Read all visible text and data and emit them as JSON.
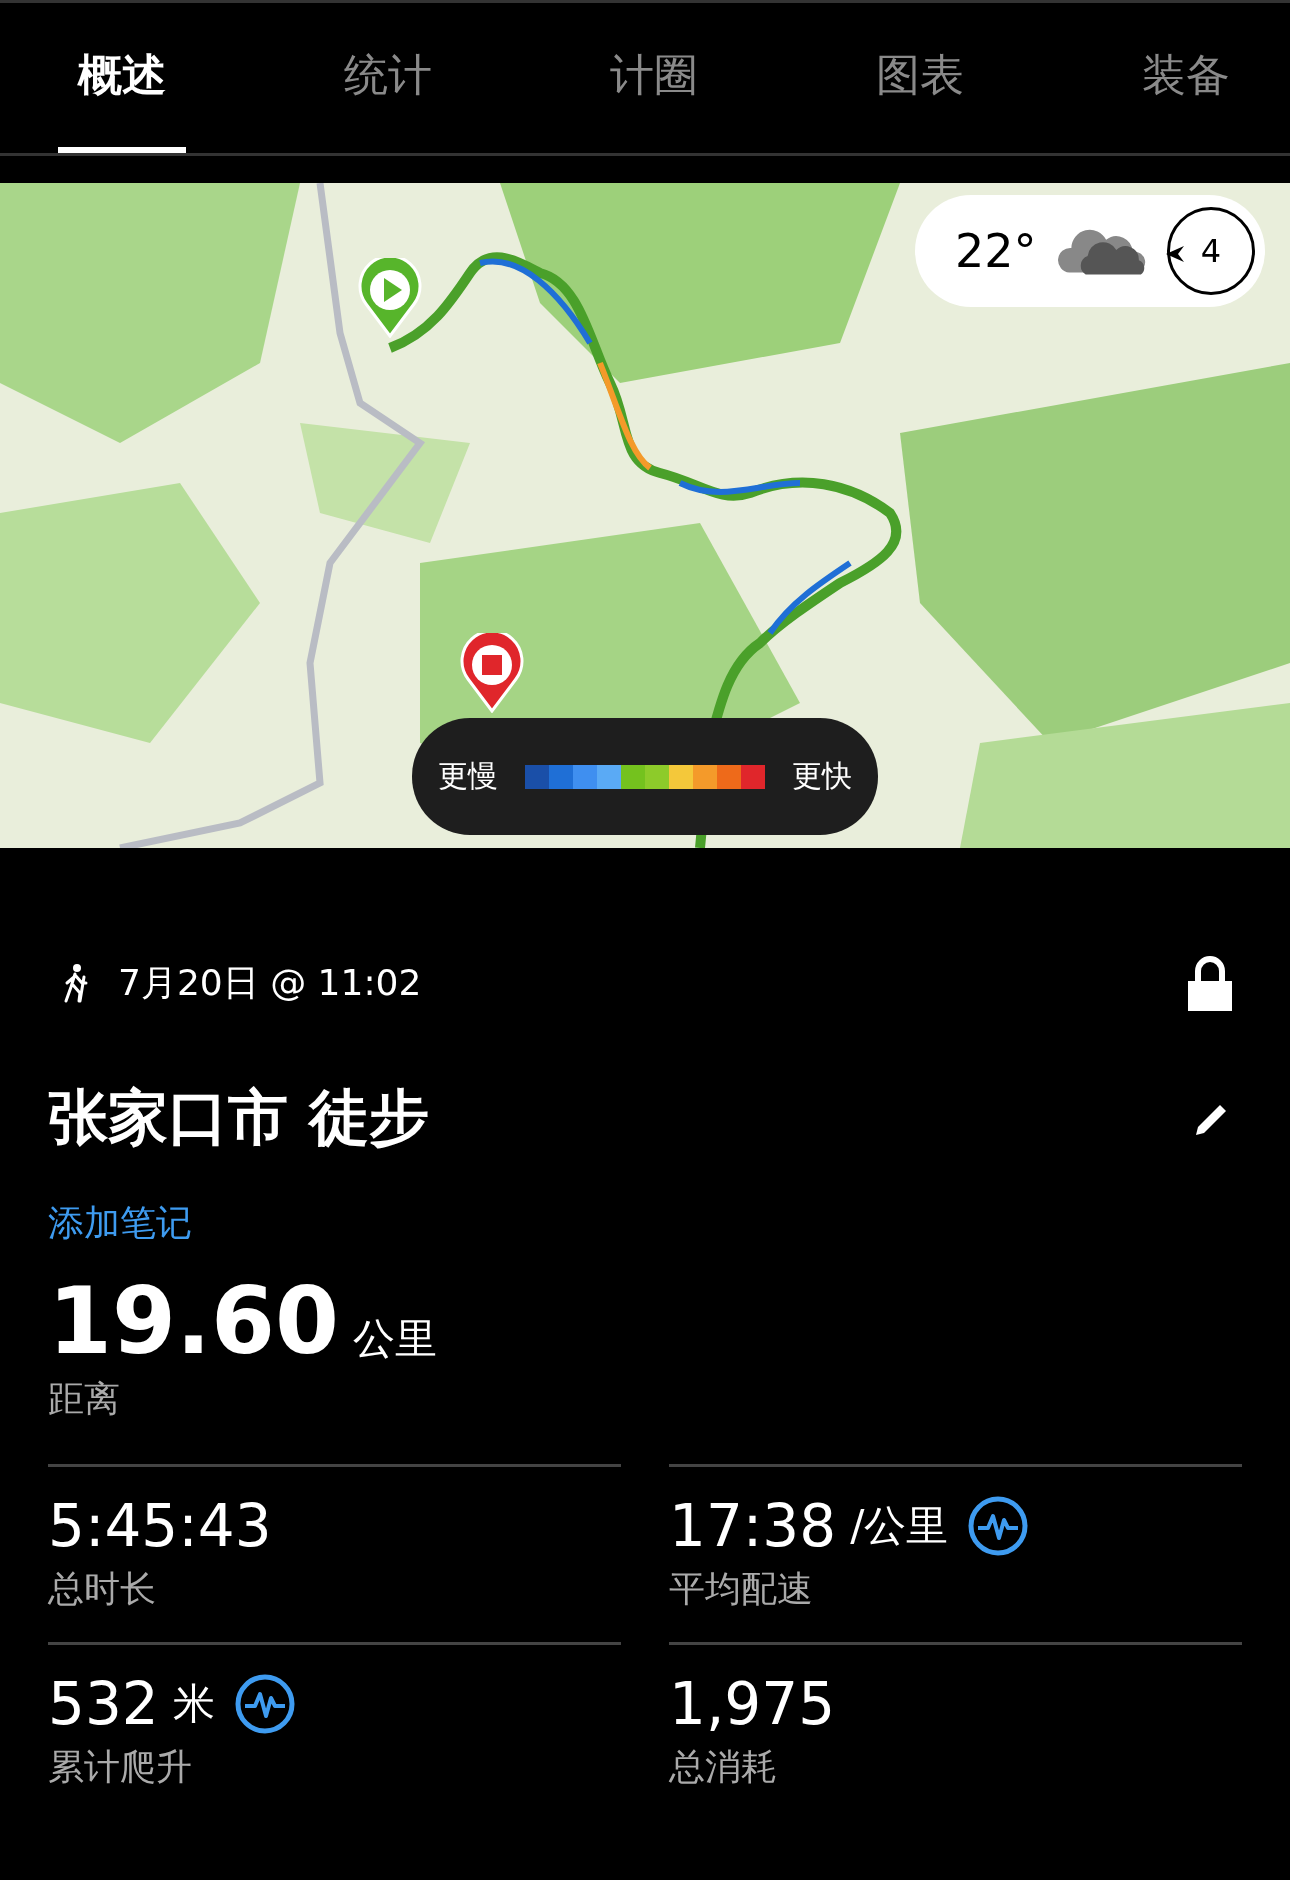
{
  "tabs": [
    {
      "label": "概述",
      "selected": true
    },
    {
      "label": "统计",
      "selected": false
    },
    {
      "label": "计圈",
      "selected": false
    },
    {
      "label": "图表",
      "selected": false
    },
    {
      "label": "装备",
      "selected": false
    }
  ],
  "map": {
    "weather": {
      "temperature": "22°",
      "wind": "4"
    },
    "legend": {
      "slower": "更慢",
      "faster": "更快",
      "colors": [
        {
          "color": "#1a4fa8"
        },
        {
          "color": "#1f6fd6"
        },
        {
          "color": "#3f8ff0"
        },
        {
          "color": "#5aaaf5"
        },
        {
          "color": "#74c21e"
        },
        {
          "color": "#8dcb2a"
        },
        {
          "color": "#f4c83a"
        },
        {
          "color": "#f49a2a"
        },
        {
          "color": "#ee6a1a"
        },
        {
          "color": "#e0262b"
        }
      ]
    }
  },
  "activity": {
    "date": "7月20日 @ 11:02",
    "title": "张家口市 徒步",
    "note_link": "添加笔记",
    "distance": {
      "value": "19.60",
      "unit": "公里",
      "label": "距离"
    }
  },
  "stats": [
    {
      "value": "5:45:43",
      "label": "总时长",
      "pulse_icon": false
    },
    {
      "value": "17:38",
      "unit": "/公里",
      "label": "平均配速",
      "pulse_icon": true
    },
    {
      "value": "532",
      "unit": "米",
      "label": "累计爬升",
      "pulse_icon": true
    },
    {
      "value": "1,975",
      "label": "总消耗",
      "pulse_icon": false
    }
  ]
}
